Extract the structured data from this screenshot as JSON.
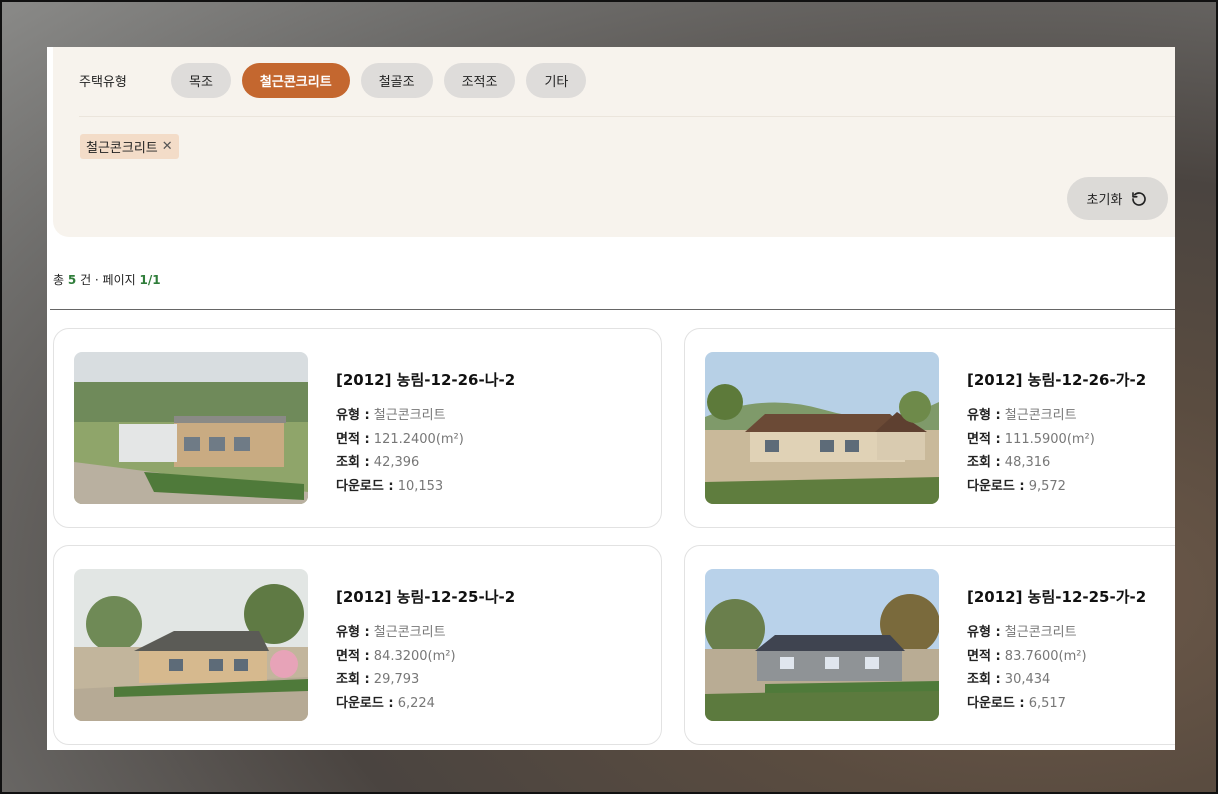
{
  "filter": {
    "label": "주택유형",
    "chips": [
      "목조",
      "철근콘크리트",
      "철골조",
      "조적조",
      "기타"
    ],
    "active_chip": "철근콘크리트",
    "selected_tag": "철근콘크리트",
    "tag_remove": "✕",
    "reset_label": "초기화"
  },
  "summary": {
    "prefix": "총",
    "count": "5",
    "unit": "건 · 페이지",
    "page": "1",
    "sep": "/",
    "total_pages": "1"
  },
  "labels": {
    "type": "유형 :",
    "area": "면적 :",
    "views": "조회 :",
    "downloads": "다운로드 :"
  },
  "cards": [
    {
      "title": "[2012] 농림-12-26-나-2",
      "type": "철근콘크리트",
      "area": "121.2400(m²)",
      "views": "42,396",
      "downloads": "10,153"
    },
    {
      "title": "[2012] 농림-12-26-가-2",
      "type": "철근콘크리트",
      "area": "111.5900(m²)",
      "views": "48,316",
      "downloads": "9,572"
    },
    {
      "title": "[2012] 농림-12-25-나-2",
      "type": "철근콘크리트",
      "area": "84.3200(m²)",
      "views": "29,793",
      "downloads": "6,224"
    },
    {
      "title": "[2012] 농림-12-25-가-2",
      "type": "철근콘크리트",
      "area": "83.7600(m²)",
      "views": "30,434",
      "downloads": "6,517"
    }
  ],
  "colors": {
    "accent": "#c4672f",
    "highlight": "#2f7d3a",
    "filter_bg": "#f7f3ed"
  }
}
